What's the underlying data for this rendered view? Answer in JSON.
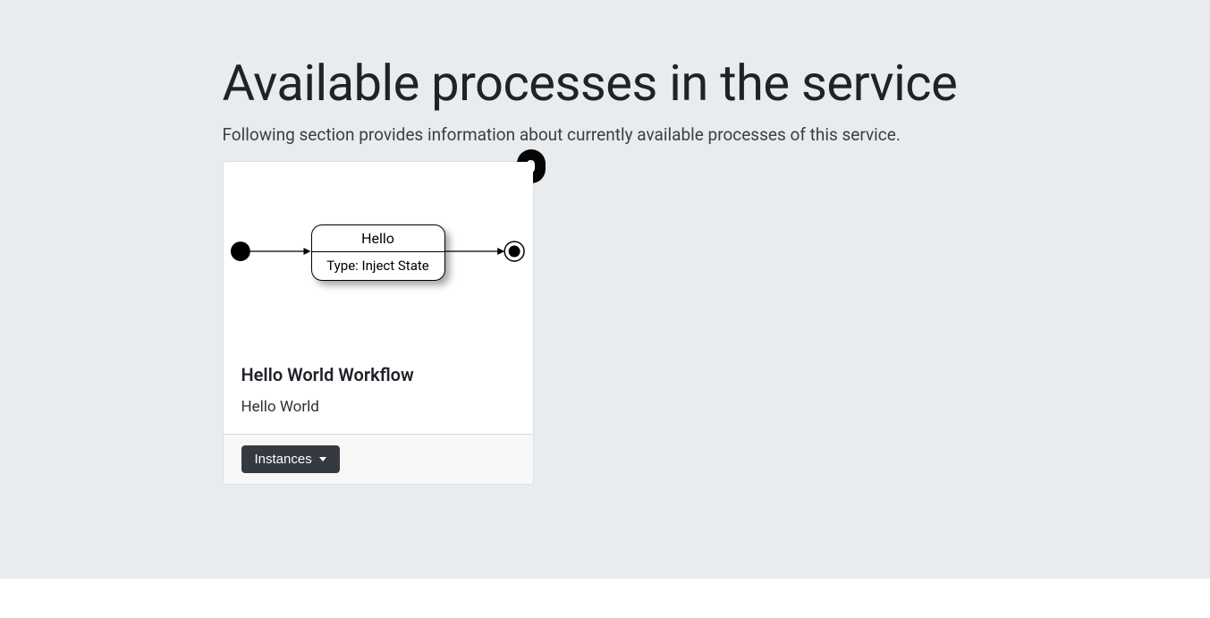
{
  "page": {
    "title": "Available processes in the service",
    "subtitle": "Following section provides information about currently available processes of this service."
  },
  "cards": [
    {
      "badge": "0",
      "diagram": {
        "state_name": "Hello",
        "state_type": "Type: Inject State"
      },
      "title": "Hello World Workflow",
      "description": "Hello World",
      "actions": {
        "instances_label": "Instances"
      }
    }
  ]
}
